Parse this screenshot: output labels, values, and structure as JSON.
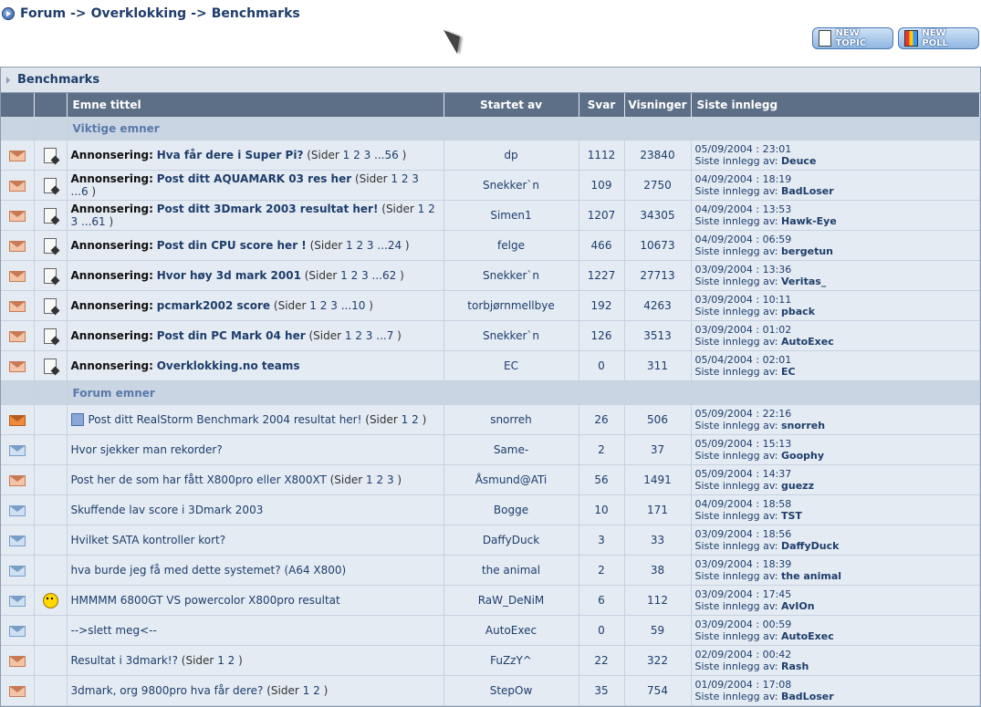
{
  "breadcrumb": {
    "items": [
      "Forum",
      "Overklokking",
      "Benchmarks"
    ],
    "separator": "->"
  },
  "buttons": {
    "new_topic": "NEW TOPIC",
    "new_poll": "NEW POLL"
  },
  "forum": {
    "title": "Benchmarks",
    "columns": [
      "Emne tittel",
      "Startet av",
      "Svar",
      "Visninger",
      "Siste innlegg"
    ],
    "last_post_prefix": "Siste innlegg av:",
    "categories": {
      "important": "Viktige emner",
      "forum": "Forum emner"
    },
    "important_topics": [
      {
        "prefix": "Annonsering:",
        "title": "Hva får dere i Super Pi?",
        "pages": [
          "1",
          "2",
          "3",
          "...56"
        ],
        "starter": "dp",
        "replies": "1112",
        "views": "23840",
        "date": "05/09/2004 : 23:01",
        "by": "Deuce"
      },
      {
        "prefix": "Annonsering:",
        "title": "Post ditt AQUAMARK 03 res her",
        "pages": [
          "1",
          "2",
          "3",
          "...6"
        ],
        "starter": "Snekker`n",
        "replies": "109",
        "views": "2750",
        "date": "04/09/2004 : 18:19",
        "by": "BadLoser"
      },
      {
        "prefix": "Annonsering:",
        "title": "Post ditt 3Dmark 2003 resultat her!",
        "pages": [
          "1",
          "2",
          "3",
          "...61"
        ],
        "starter": "Simen1",
        "replies": "1207",
        "views": "34305",
        "date": "04/09/2004 : 13:53",
        "by": "Hawk-Eye"
      },
      {
        "prefix": "Annonsering:",
        "title": "Post din CPU score her !",
        "pages": [
          "1",
          "2",
          "3",
          "...24"
        ],
        "starter": "felge",
        "replies": "466",
        "views": "10673",
        "date": "04/09/2004 : 06:59",
        "by": "bergetun"
      },
      {
        "prefix": "Annonsering:",
        "title": "Hvor høy 3d mark 2001",
        "pages": [
          "1",
          "2",
          "3",
          "...62"
        ],
        "starter": "Snekker`n",
        "replies": "1227",
        "views": "27713",
        "date": "03/09/2004 : 13:36",
        "by": "Veritas_"
      },
      {
        "prefix": "Annonsering:",
        "title": "pcmark2002 score",
        "pages": [
          "1",
          "2",
          "3",
          "...10"
        ],
        "starter": "torbjørnmellbye",
        "replies": "192",
        "views": "4263",
        "date": "03/09/2004 : 10:11",
        "by": "pback"
      },
      {
        "prefix": "Annonsering:",
        "title": "Post din PC Mark 04 her",
        "pages": [
          "1",
          "2",
          "3",
          "...7"
        ],
        "starter": "Snekker`n",
        "replies": "126",
        "views": "3513",
        "date": "03/09/2004 : 01:02",
        "by": "AutoExec"
      },
      {
        "prefix": "Annonsering:",
        "title": "Overklokking.no teams",
        "pages": [],
        "starter": "EC",
        "replies": "0",
        "views": "311",
        "date": "05/04/2004 : 02:01",
        "by": "EC"
      }
    ],
    "pages_label": "Sider",
    "forum_topics": [
      {
        "title": "Post ditt RealStorm Benchmark 2004 resultat her!",
        "pages": [
          "1",
          "2"
        ],
        "starter": "snorreh",
        "replies": "26",
        "views": "506",
        "date": "05/09/2004 : 22:16",
        "by": "snorreh",
        "icon": "hot",
        "smile": false,
        "tinyicon": true
      },
      {
        "title": "Hvor sjekker man rekorder?",
        "pages": [],
        "starter": "Same-",
        "replies": "2",
        "views": "37",
        "date": "05/09/2004 : 15:13",
        "by": "Goophy",
        "icon": "blue",
        "smile": false,
        "tinyicon": false
      },
      {
        "title": "Post her de som har fått X800pro eller X800XT",
        "pages": [
          "1",
          "2",
          "3"
        ],
        "starter": "Åsmund@ATi",
        "replies": "56",
        "views": "1491",
        "date": "05/09/2004 : 14:37",
        "by": "guezz",
        "icon": "normal",
        "smile": false,
        "tinyicon": false
      },
      {
        "title": "Skuffende lav score i 3Dmark 2003",
        "pages": [],
        "starter": "Bogge",
        "replies": "10",
        "views": "171",
        "date": "04/09/2004 : 18:58",
        "by": "TST",
        "icon": "blue",
        "smile": false,
        "tinyicon": false
      },
      {
        "title": "Hvilket SATA kontroller kort?",
        "pages": [],
        "starter": "DaffyDuck",
        "replies": "3",
        "views": "33",
        "date": "03/09/2004 : 18:56",
        "by": "DaffyDuck",
        "icon": "blue",
        "smile": false,
        "tinyicon": false
      },
      {
        "title": "hva burde jeg få med dette systemet? (A64 X800)",
        "pages": [],
        "starter": "the animal",
        "replies": "2",
        "views": "38",
        "date": "03/09/2004 : 18:39",
        "by": "the animal",
        "icon": "blue",
        "smile": false,
        "tinyicon": false
      },
      {
        "title": "HMMMM 6800GT VS powercolor X800pro resultat",
        "pages": [],
        "starter": "RaW_DeNiM",
        "replies": "6",
        "views": "112",
        "date": "03/09/2004 : 17:45",
        "by": "AvIOn",
        "icon": "blue",
        "smile": true,
        "tinyicon": false
      },
      {
        "title": "-->slett meg<--",
        "pages": [],
        "starter": "AutoExec",
        "replies": "0",
        "views": "59",
        "date": "03/09/2004 : 00:59",
        "by": "AutoExec",
        "icon": "blue",
        "smile": false,
        "tinyicon": false
      },
      {
        "title": "Resultat i 3dmark!?",
        "pages": [
          "1",
          "2"
        ],
        "starter": "FuZzY^",
        "replies": "22",
        "views": "322",
        "date": "02/09/2004 : 00:42",
        "by": "Rash",
        "icon": "normal",
        "smile": false,
        "tinyicon": false
      },
      {
        "title": "3dmark, org 9800pro hva får dere?",
        "pages": [
          "1",
          "2"
        ],
        "starter": "StepOw",
        "replies": "35",
        "views": "754",
        "date": "01/09/2004 : 17:08",
        "by": "BadLoser",
        "icon": "normal",
        "smile": false,
        "tinyicon": false
      }
    ]
  }
}
